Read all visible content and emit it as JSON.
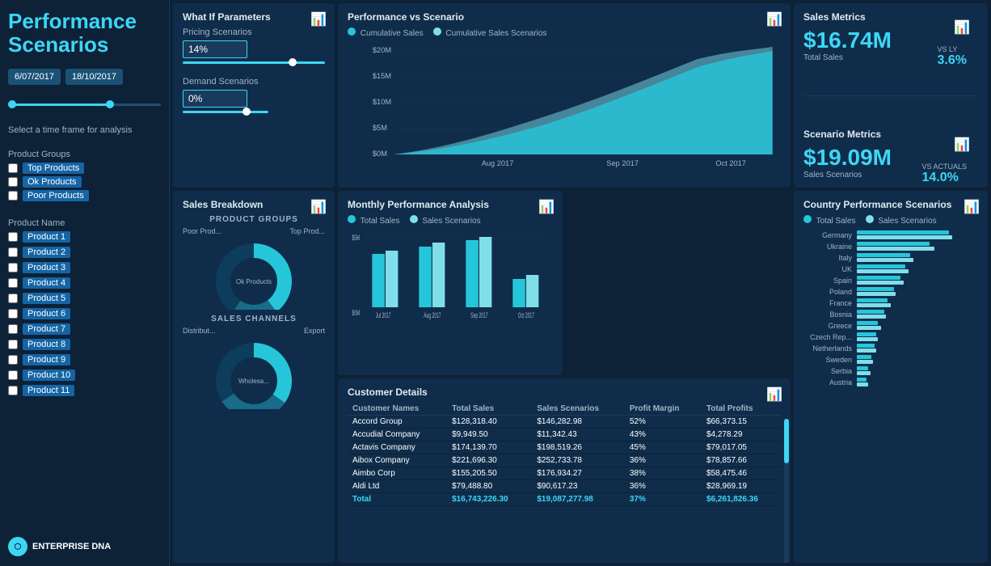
{
  "sidebar": {
    "title": "Performance\nScenarios",
    "date_start": "6/07/2017",
    "date_end": "18/10/2017",
    "timeframe_label": "Select a time frame for analysis",
    "product_groups_label": "Product Groups",
    "product_groups": [
      {
        "label": "Top Products",
        "checked": false
      },
      {
        "label": "Ok Products",
        "checked": false
      },
      {
        "label": "Poor Products",
        "checked": false
      }
    ],
    "product_name_label": "Product Name",
    "products": [
      "Product 1",
      "Product 2",
      "Product 3",
      "Product 4",
      "Product 5",
      "Product 6",
      "Product 7",
      "Product 8",
      "Product 9",
      "Product 10",
      "Product 11"
    ],
    "enterprise_label": "ENTERPRISE",
    "dna_label": "DNA"
  },
  "what_if": {
    "title": "What If Parameters",
    "pricing_label": "Pricing Scenarios",
    "pricing_value": "14%",
    "demand_label": "Demand Scenarios",
    "demand_value": "0%"
  },
  "perf_scenario": {
    "title": "Performance vs Scenario",
    "legend": [
      {
        "label": "Cumulative Sales",
        "color": "#26c6da"
      },
      {
        "label": "Cumulative Sales Scenarios",
        "color": "#80deea"
      }
    ],
    "x_labels": [
      "Aug 2017",
      "Sep 2017",
      "Oct 2017"
    ],
    "y_labels": [
      "$20M",
      "$15M",
      "$10M",
      "$5M",
      "$0M"
    ]
  },
  "sales_metrics": {
    "title": "Sales Metrics",
    "total_sales_value": "$16.74M",
    "total_sales_label": "Total Sales",
    "vs_ly_label": "VS LY",
    "vs_ly_value": "3.6%",
    "scenario_metrics_title": "Scenario Metrics",
    "sales_scenarios_value": "$19.09M",
    "sales_scenarios_label": "Sales Scenarios",
    "vs_actuals_label": "VS ACTUALS",
    "vs_actuals_value": "14.0%"
  },
  "sales_breakdown": {
    "title": "Sales Breakdown",
    "product_groups_label": "PRODUCT GROUPS",
    "donut1_labels": [
      "Poor Prod...",
      "Top Prod..."
    ],
    "donut1_segments": [
      {
        "label": "Poor Products",
        "value": 20,
        "color": "#1a6b8a"
      },
      {
        "label": "Ok Products",
        "value": 40,
        "color": "#0d3d5c"
      },
      {
        "label": "Top Products",
        "value": 40,
        "color": "#26c6da"
      }
    ],
    "ok_label": "Ok Products",
    "sales_channels_label": "SALES CHANNELS",
    "donut2_labels": [
      "Distribut...",
      "Export"
    ],
    "donut2_segments": [
      {
        "label": "Wholesale",
        "value": 35,
        "color": "#0d3d5c"
      },
      {
        "label": "Distributor",
        "value": 35,
        "color": "#26c6da"
      },
      {
        "label": "Export",
        "value": 30,
        "color": "#1a6b8a"
      }
    ],
    "wholesale_label": "Wholesa..."
  },
  "monthly_perf": {
    "title": "Monthly Performance Analysis",
    "legend": [
      {
        "label": "Total Sales",
        "color": "#26c6da"
      },
      {
        "label": "Sales Scenarios",
        "color": "#80deea"
      }
    ],
    "x_labels": [
      "Jul 2017",
      "Aug 2017",
      "Sep 2017",
      "Oct 2017"
    ],
    "y_labels": [
      "$5M",
      "$0M"
    ],
    "bars": [
      {
        "total": 60,
        "scenario": 65
      },
      {
        "total": 70,
        "scenario": 75
      },
      {
        "total": 80,
        "scenario": 85
      },
      {
        "total": 30,
        "scenario": 35
      }
    ]
  },
  "country_perf": {
    "title": "Country Performance Scenarios",
    "legend": [
      {
        "label": "Total Sales",
        "color": "#26c6da"
      },
      {
        "label": "Sales Scenarios",
        "color": "#80deea"
      }
    ],
    "countries": [
      {
        "name": "Germany",
        "sales": 95,
        "scenario": 98
      },
      {
        "name": "Ukraine",
        "sales": 75,
        "scenario": 80
      },
      {
        "name": "Italy",
        "sales": 55,
        "scenario": 58
      },
      {
        "name": "UK",
        "sales": 50,
        "scenario": 53
      },
      {
        "name": "Spain",
        "sales": 45,
        "scenario": 48
      },
      {
        "name": "Poland",
        "sales": 38,
        "scenario": 40
      },
      {
        "name": "France",
        "sales": 32,
        "scenario": 35
      },
      {
        "name": "Bosnia",
        "sales": 28,
        "scenario": 30
      },
      {
        "name": "Greece",
        "sales": 22,
        "scenario": 25
      },
      {
        "name": "Czech Rep...",
        "sales": 20,
        "scenario": 22
      },
      {
        "name": "Netherlands",
        "sales": 18,
        "scenario": 20
      },
      {
        "name": "Sweden",
        "sales": 15,
        "scenario": 17
      },
      {
        "name": "Serbia",
        "sales": 12,
        "scenario": 14
      },
      {
        "name": "Austria",
        "sales": 10,
        "scenario": 12
      }
    ]
  },
  "customer_details": {
    "title": "Customer Details",
    "columns": [
      "Customer Names",
      "Total Sales",
      "Sales Scenarios",
      "Profit Margin",
      "Total Profits"
    ],
    "rows": [
      {
        "name": "Accord Group",
        "total_sales": "$128,318.40",
        "scenarios": "$146,282.98",
        "margin": "52%",
        "profits": "$66,373.15"
      },
      {
        "name": "Accudial Company",
        "total_sales": "$9,949.50",
        "scenarios": "$11,342.43",
        "margin": "43%",
        "profits": "$4,278.29"
      },
      {
        "name": "Actavis Company",
        "total_sales": "$174,139.70",
        "scenarios": "$198,519.26",
        "margin": "45%",
        "profits": "$79,017.05"
      },
      {
        "name": "Aibox Company",
        "total_sales": "$221,696.30",
        "scenarios": "$252,733.78",
        "margin": "36%",
        "profits": "$78,857.66"
      },
      {
        "name": "Aimbo Corp",
        "total_sales": "$155,205.50",
        "scenarios": "$176,934.27",
        "margin": "38%",
        "profits": "$58,475.46"
      },
      {
        "name": "Aldi Ltd",
        "total_sales": "$79,488.80",
        "scenarios": "$90,617.23",
        "margin": "36%",
        "profits": "$28,969.19"
      }
    ],
    "total_row": {
      "name": "Total",
      "total_sales": "$16,743,226.30",
      "scenarios": "$19,087,277.98",
      "margin": "37%",
      "profits": "$6,261,826.36"
    }
  },
  "colors": {
    "accent": "#26c6da",
    "accent2": "#80deea",
    "bg_dark": "#0d2137",
    "bg_card": "#0f2d4a",
    "text_muted": "#a0b4c8",
    "highlight": "#3dd6f5"
  }
}
